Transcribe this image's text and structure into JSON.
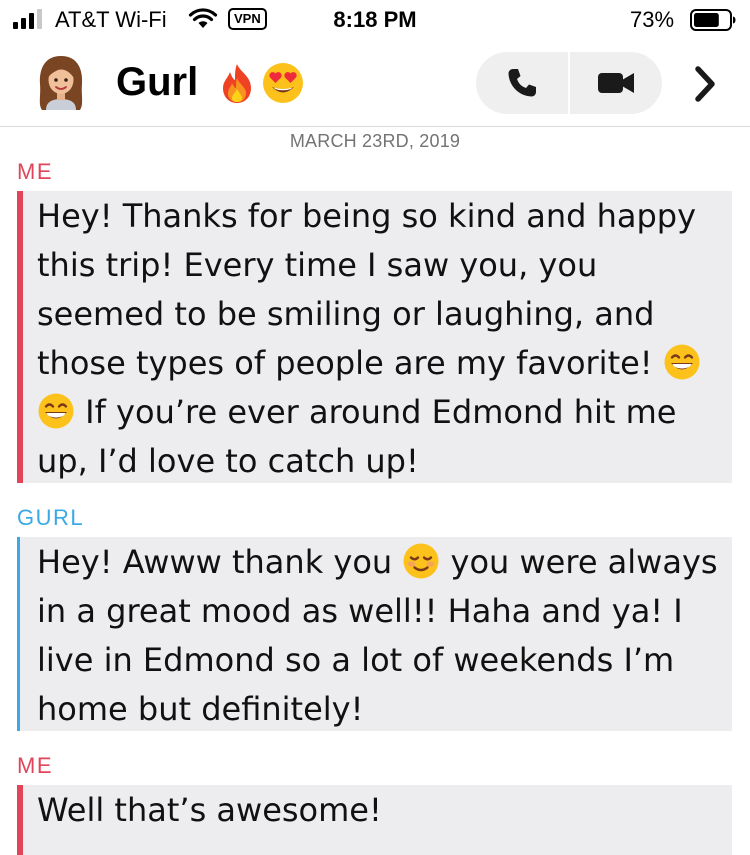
{
  "status_bar": {
    "carrier": "AT&T Wi-Fi",
    "vpn": "VPN",
    "time": "8:18 PM",
    "battery_percent": "73%",
    "battery_level": 0.73,
    "signal_bars_filled": 3,
    "signal_bars_total": 4
  },
  "header": {
    "chat_name": "Gurl",
    "name_emojis": [
      "fire",
      "smiling-face-with-heart-eyes"
    ],
    "actions": [
      "phone-icon",
      "video-camera-icon",
      "chevron-right-icon"
    ]
  },
  "conversation": {
    "date": "MARCH 23RD, 2019",
    "messages": [
      {
        "sender": "ME",
        "text_before_emoji": "Hey! Thanks for being so kind and happy this trip! Every time I saw you, you seemed to be smiling or laughing, and those types of people are my favorite! ",
        "emojis": [
          "grinning-face-with-smiling-eyes",
          "grinning-face-with-smiling-eyes"
        ],
        "text_after_emoji": " If you’re ever around Edmond hit me up, I’d love to catch up!"
      },
      {
        "sender": "GURL",
        "text_before_emoji": "Hey! Awww thank you ",
        "emojis": [
          "smiling-face"
        ],
        "text_after_emoji": " you were always in a great mood as well!! Haha and ya! I live in Edmond so a lot of weekends I’m home but definitely!"
      },
      {
        "sender": "ME",
        "text": "Well that’s awesome!"
      }
    ]
  },
  "colors": {
    "me_accent": "#e0455a",
    "friend_accent": "#3aa9e6",
    "bubble_bg": "#ededef",
    "date_text": "#737373"
  }
}
